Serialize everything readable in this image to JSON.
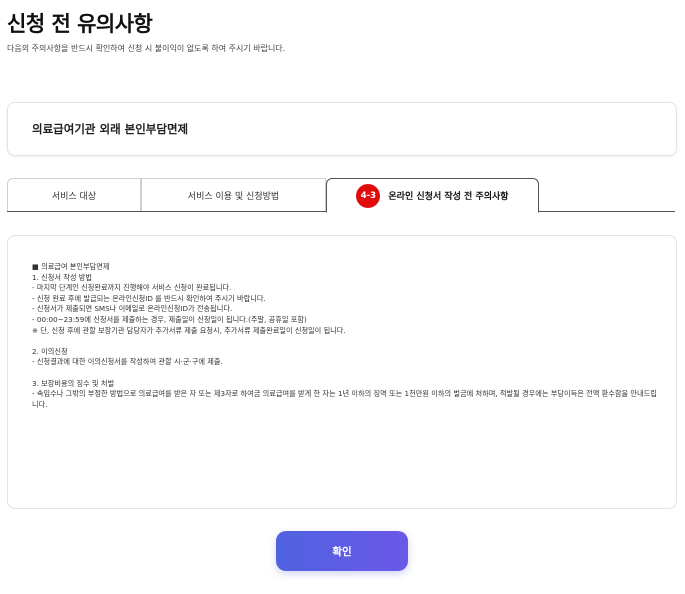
{
  "header": {
    "title": "신청 전 유의사항",
    "subtitle": "다음의 주의사항을 반드시 확인하여 신청 시 불이익이 없도록 하여 주시기 바랍니다."
  },
  "service": {
    "title": "의료급여기관 외래 본인부담면제"
  },
  "tabs": [
    {
      "label": "서비스 대상"
    },
    {
      "label": "서비스 이용 및 신청방법"
    },
    {
      "badge": "4-3",
      "label": "온라인 신청서 작성 전 주의사항"
    }
  ],
  "notice": {
    "lines": [
      "■ 의료급여 본인부담면제",
      "1. 신청서 작성 방법",
      "- 마지막 단계인 신청완료까지 진행해야 서비스 신청이 완료됩니다.",
      "- 신청 완료 후에 발급되는 온라인신청ID 를 반드시 확인하여 주시기 바랍니다.",
      "- 신청서가 제출되면 SMS나 이메일로 온라인신청ID가 전송됩니다.",
      "- 00:00~23:59에 신청서를 제출하는 경우, 제출일이 신청일이 됩니다.(주말, 공휴일 포함)",
      "※ 단, 신청 후에 관할 보장기관 담당자가 추가서류 제출 요청시, 추가서류 제출완료일이 신청일이 됩니다.",
      "",
      "2. 이의신청",
      "- 신청결과에 대한 이의신청서를 작성하여 관할 시·군·구에 제출.",
      "",
      "3. 보장비용의 징수 및 처벌",
      "- 속임수나 그밖의 부정한 방법으로 의료급여를 받은 자 또는 제3자로 하여금 의료급여를 받게 한 자는 1년 이하의 징역 또는 1천만원 이하의 벌금에 처하며, 적발될 경우에는 부당이득은 전액 환수함을 안내드립니다."
    ]
  },
  "actions": {
    "confirm_label": "확인"
  }
}
